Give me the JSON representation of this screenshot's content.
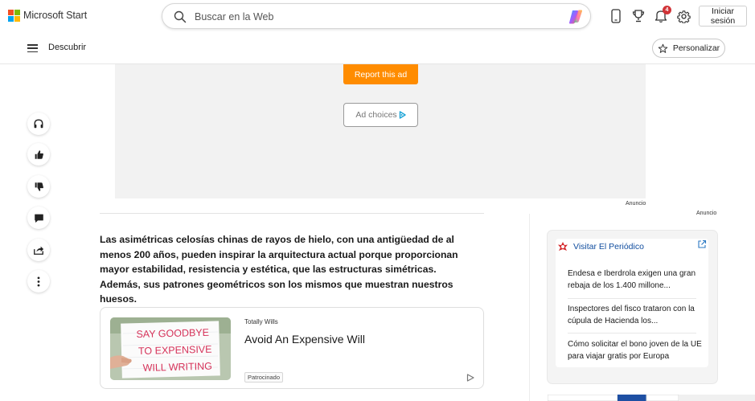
{
  "header": {
    "brand": "Microsoft Start",
    "brand_colors": [
      "#f25022",
      "#7fba00",
      "#00a4ef",
      "#ffb900"
    ],
    "search_placeholder": "Buscar en la Web",
    "notification_count": "4",
    "signin_label": "Iniciar sesión",
    "icons": [
      "search-icon",
      "copilot-icon",
      "phone-icon",
      "trophy-icon",
      "bell-icon",
      "gear-icon"
    ]
  },
  "subnav": {
    "discover_label": "Descubrir",
    "personalize_label": "Personalizar"
  },
  "rail": {
    "icons": [
      "headphones-icon",
      "thumbs-up-icon",
      "thumbs-down-icon",
      "comment-icon",
      "share-icon",
      "more-icon"
    ]
  },
  "ad": {
    "report_label": "Report this ad",
    "choices_label": "Ad choices",
    "anuncio_label": "Anuncio",
    "report_color": "#ff8c00"
  },
  "article": {
    "lead": "Las asimétricas celosías chinas de rayos de hielo, con una antigüedad de al menos 200 años, pueden inspirar la arquitectura actual porque proporcionan mayor estabilidad, resistencia y estética, que las estructuras simétricas. Además, sus patrones geométricos son los mismos que muestran nuestros huesos."
  },
  "promo": {
    "image_text": [
      "SAY GOODBYE",
      "TO EXPENSIVE",
      "WILL WRITING"
    ],
    "source": "Totally Wills",
    "title": "Avoid An Expensive Will",
    "tag": "Patrocinado"
  },
  "panel": {
    "title": "Visitar El Periódico",
    "items": [
      "Endesa e Iberdrola exigen una gran rebaja de los 1.400 millone...",
      "Inspectores del fisco trataron con la cúpula de Hacienda los...",
      "Cómo solicitar el bono joven de la UE para viajar gratis por Europa"
    ]
  }
}
